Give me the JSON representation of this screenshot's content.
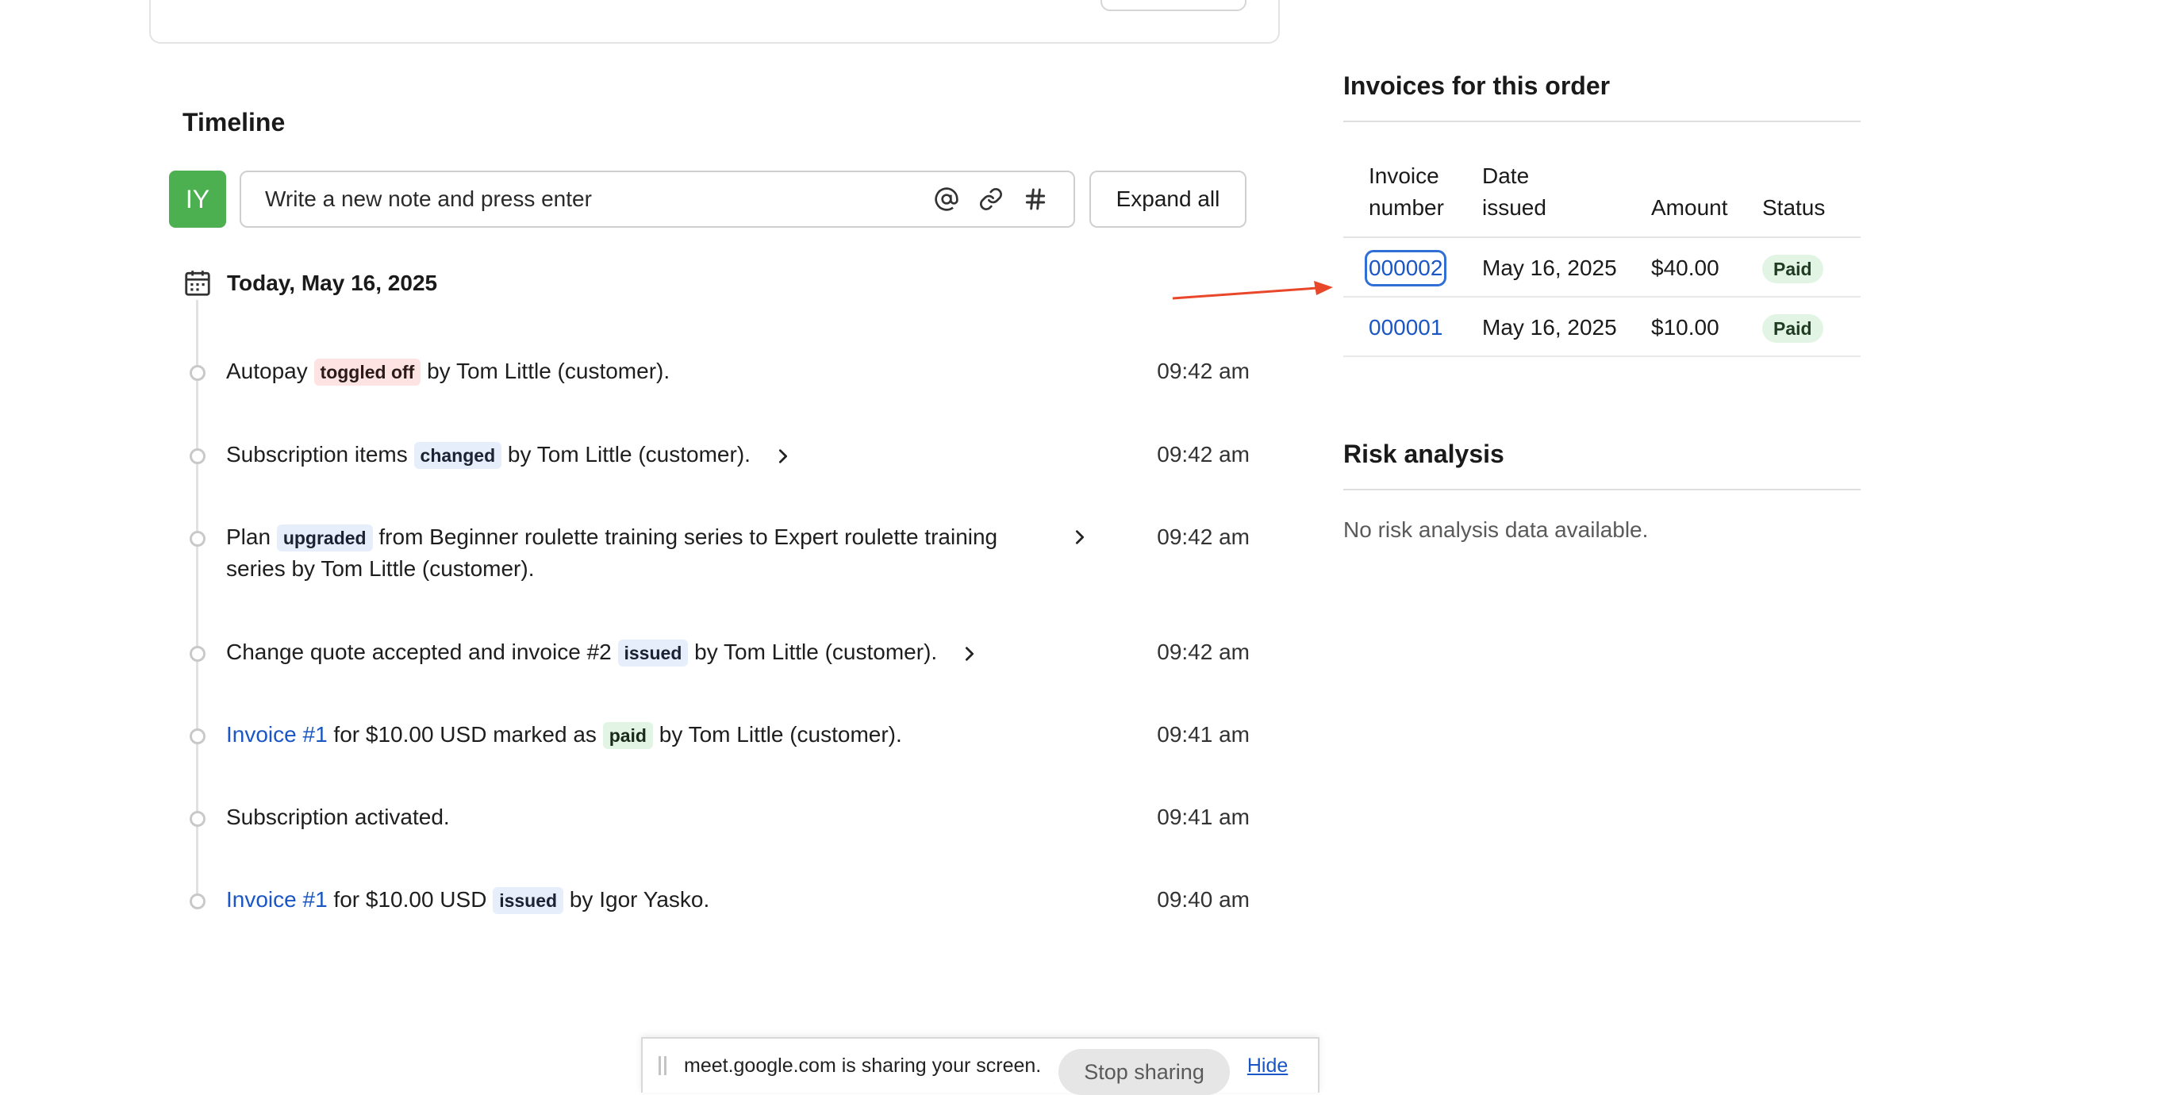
{
  "timeline": {
    "title": "Timeline",
    "avatar_initials": "IY",
    "note_placeholder": "Write a new note and press enter",
    "expand_all_label": "Expand all",
    "date_label": "Today, May 16, 2025",
    "events": [
      {
        "pre": "Autopay",
        "badge": "toggled off",
        "post": "by Tom Little (customer).",
        "time": "09:42 am"
      },
      {
        "pre": "Subscription items",
        "badge": "changed",
        "post": "by Tom Little (customer).",
        "time": "09:42 am"
      },
      {
        "pre": "Plan",
        "badge": "upgraded",
        "post_line1": "from Beginner roulette training series to Expert roulette training",
        "post_line2": "series by Tom Little (customer).",
        "time": "09:42 am"
      },
      {
        "pre": "Change quote accepted and invoice #2",
        "badge": "issued",
        "post": "by Tom Little (customer).",
        "time": "09:42 am"
      },
      {
        "link": "Invoice #1",
        "pre": "for $10.00 USD marked as",
        "badge": "paid",
        "post": "by Tom Little (customer).",
        "time": "09:41 am"
      },
      {
        "pre": "Subscription activated.",
        "time": "09:41 am"
      },
      {
        "link": "Invoice #1",
        "pre": "for $10.00 USD",
        "badge": "issued",
        "post": "by Igor Yasko.",
        "time": "09:40 am"
      }
    ]
  },
  "invoices": {
    "title": "Invoices for this order",
    "columns": [
      "Invoice number",
      "Date issued",
      "Amount",
      "Status"
    ],
    "col_labels": {
      "number_l1": "Invoice",
      "number_l2": "number",
      "date_l1": "Date",
      "date_l2": "issued",
      "amount": "Amount",
      "status": "Status"
    },
    "rows": [
      {
        "number": "000002",
        "date": "May 16, 2025",
        "amount": "$40.00",
        "status": "Paid"
      },
      {
        "number": "000001",
        "date": "May 16, 2025",
        "amount": "$10.00",
        "status": "Paid"
      }
    ]
  },
  "risk": {
    "title": "Risk analysis",
    "empty_text": "No risk analysis data available."
  },
  "share_bar": {
    "message": "meet.google.com is sharing your screen.",
    "stop_label": "Stop sharing",
    "hide_label": "Hide"
  },
  "colors": {
    "avatar": "#4caf50",
    "link": "#1a56c4",
    "annotation_arrow": "#e8472a"
  },
  "icons": [
    "mention-icon",
    "attachment-icon",
    "hashtag-icon",
    "calendar-icon",
    "chevron-right-icon"
  ]
}
